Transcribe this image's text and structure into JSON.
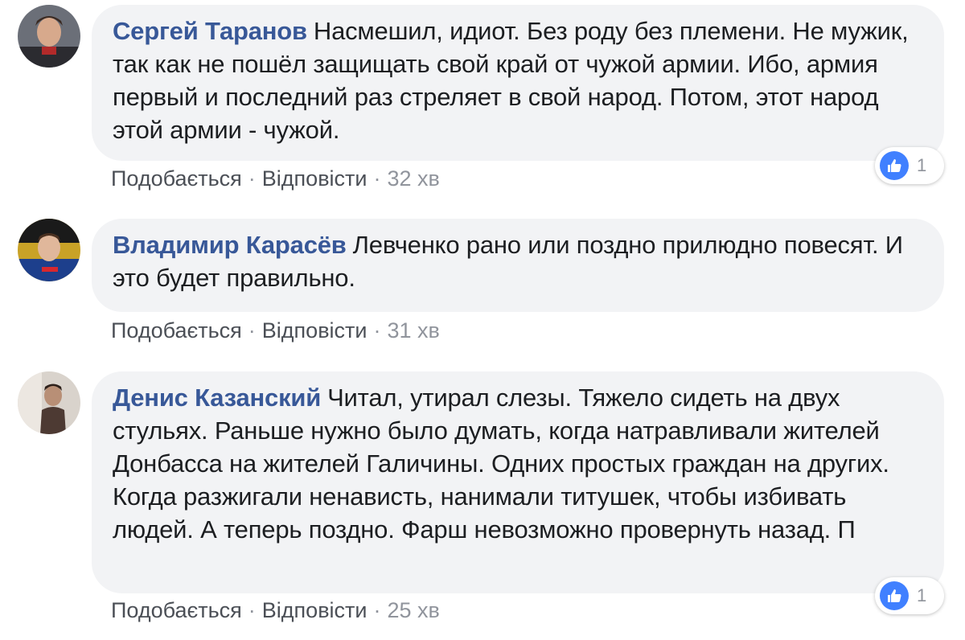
{
  "colors": {
    "author": "#385898",
    "bubble_bg": "#f2f3f5",
    "meta": "#90949c",
    "like_blue": "#4080ff"
  },
  "comments": [
    {
      "author": "Сергей Таранов",
      "text": "Насмешил, идиот. Без роду без племени. Не мужик, так как не пошёл защищать свой край от чужой армии. Ибо, армия первый и последний раз стреляет в свой народ. Потом, этот народ этой армии - чужой.",
      "like_label": "Подобається",
      "reply_label": "Відповісти",
      "time": "32 хв",
      "reactions": {
        "icon": "thumbs-up-icon",
        "count": "1"
      }
    },
    {
      "author": "Владимир Карасёв",
      "text": "Левченко рано или поздно прилюдно повесят. И это будет правильно.",
      "like_label": "Подобається",
      "reply_label": "Відповісти",
      "time": "31 хв"
    },
    {
      "author": "Денис Казанский",
      "text": "Читал, утирал слезы. Тяжело сидеть на двух стульях. Раньше нужно было думать, когда натравливали жителей Донбасса на жителей Галичины. Одних простых граждан на других. Когда разжигали ненависть, нанимали титушек, чтобы избивать людей. А теперь поздно. Фарш невозможно провернуть назад. П",
      "like_label": "Подобається",
      "reply_label": "Відповісти",
      "time": "25 хв",
      "reactions": {
        "icon": "thumbs-up-icon",
        "count": "1"
      }
    }
  ]
}
